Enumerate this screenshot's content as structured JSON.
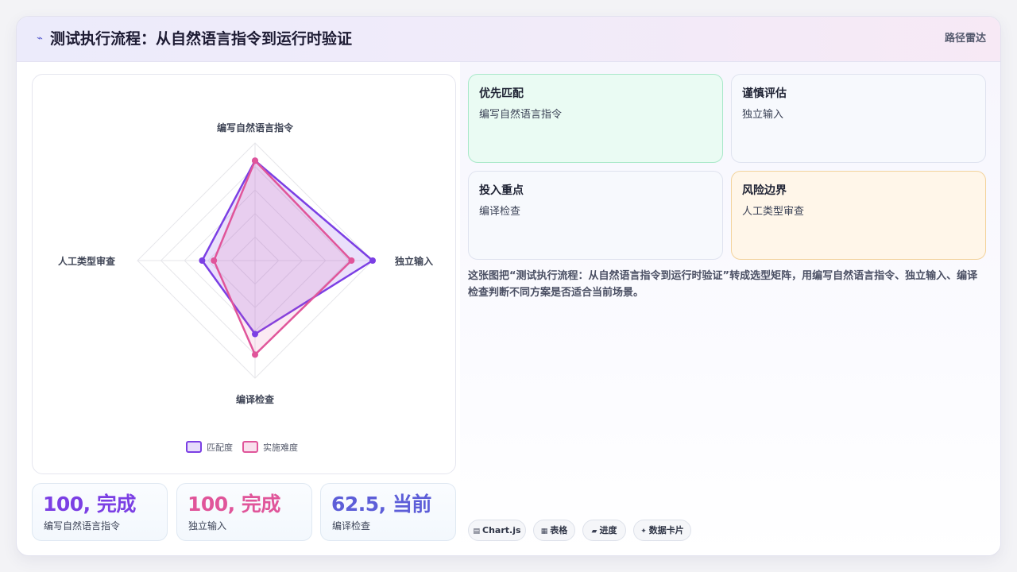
{
  "header": {
    "logo_icon": "sparkline-icon",
    "title": "测试执行流程：从自然语言指令到运行时验证",
    "right_label": "路径雷达"
  },
  "chart_data": {
    "type": "radar",
    "categories": [
      "编写自然语言指令",
      "独立输入",
      "编译检查",
      "人工类型审查"
    ],
    "rlim": [
      0,
      100
    ],
    "grid": true,
    "legend_position": "bottom",
    "series": [
      {
        "name": "匹配度",
        "values": [
          85,
          100,
          62.5,
          45
        ],
        "color": "#7b3fe4"
      },
      {
        "name": "实施难度",
        "values": [
          85,
          82,
          80,
          35
        ],
        "color": "#e0559a"
      }
    ]
  },
  "stats": [
    {
      "value": "100, 完成",
      "label": "编写自然语言指令",
      "color": "#7b3fe4"
    },
    {
      "value": "100, 完成",
      "label": "独立输入",
      "color": "#e0559a"
    },
    {
      "value": "62.5, 当前",
      "label": "编译检查",
      "color": "#5d5ed8"
    }
  ],
  "tiles": [
    {
      "title": "优先匹配",
      "desc": "编写自然语言指令",
      "bg": "#eafbf3",
      "border": "#a9e8c9"
    },
    {
      "title": "谨慎评估",
      "desc": "独立输入",
      "bg": "#f7f9fd",
      "border": "#dfe3ef"
    },
    {
      "title": "投入重点",
      "desc": "编译检查",
      "bg": "#f7f9fd",
      "border": "#dfe3ef"
    },
    {
      "title": "风险边界",
      "desc": "人工类型审查",
      "bg": "#fff6e9",
      "border": "#f3d39c"
    }
  ],
  "description": "这张图把“测试执行流程：从自然语言指令到运行时验证”转成选型矩阵，用编写自然语言指令、独立输入、编译检查判断不同方案是否适合当前场景。",
  "pills": [
    {
      "icon": "chart-icon",
      "glyph": "▤",
      "label": "Chart.js"
    },
    {
      "icon": "table-icon",
      "glyph": "▦",
      "label": "表格"
    },
    {
      "icon": "progress-icon",
      "glyph": "▰",
      "label": "进度"
    },
    {
      "icon": "sparkle-icon",
      "glyph": "✦",
      "label": "数据卡片"
    }
  ]
}
